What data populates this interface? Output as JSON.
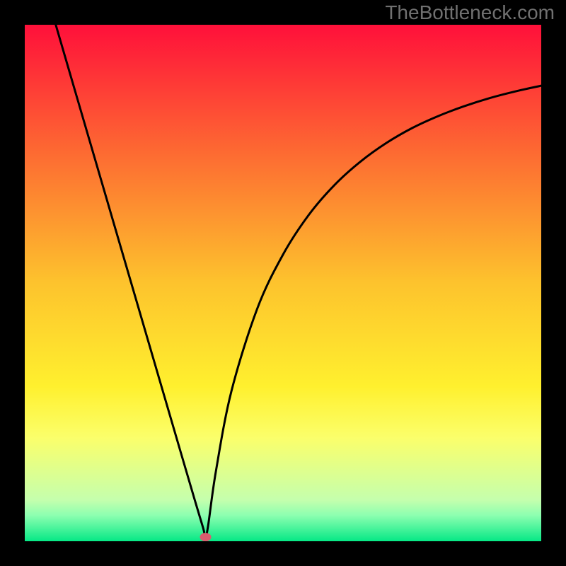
{
  "watermark": "TheBottleneck.com",
  "chart_data": {
    "type": "line",
    "title": "",
    "xlabel": "",
    "ylabel": "",
    "xlim": [
      0,
      100
    ],
    "ylim": [
      0,
      100
    ],
    "gradient_stops": [
      {
        "offset": 0,
        "color": "#ff103a"
      },
      {
        "offset": 25,
        "color": "#fd6b32"
      },
      {
        "offset": 50,
        "color": "#fdc32d"
      },
      {
        "offset": 70,
        "color": "#fff02e"
      },
      {
        "offset": 80,
        "color": "#fbff6b"
      },
      {
        "offset": 92,
        "color": "#c5ffad"
      },
      {
        "offset": 95,
        "color": "#8cffb0"
      },
      {
        "offset": 100,
        "color": "#06e886"
      }
    ],
    "series": [
      {
        "name": "curve",
        "x": [
          6,
          10,
          15,
          20,
          25,
          30,
          33,
          34.5,
          35,
          35.5,
          37,
          40,
          45,
          50,
          55,
          60,
          65,
          70,
          75,
          80,
          85,
          90,
          95,
          100
        ],
        "y": [
          100,
          86.3,
          69.2,
          52.1,
          35.0,
          17.9,
          7.7,
          2.7,
          1.0,
          3.0,
          13.5,
          29.0,
          45.0,
          55.5,
          63.2,
          69.0,
          73.5,
          77.1,
          80.0,
          82.3,
          84.2,
          85.8,
          87.1,
          88.2
        ]
      }
    ],
    "marker": {
      "x": 35,
      "y": 0.8,
      "color": "#db5c6e",
      "radius": 7
    },
    "background": "#000000",
    "curve_color": "#000000"
  }
}
